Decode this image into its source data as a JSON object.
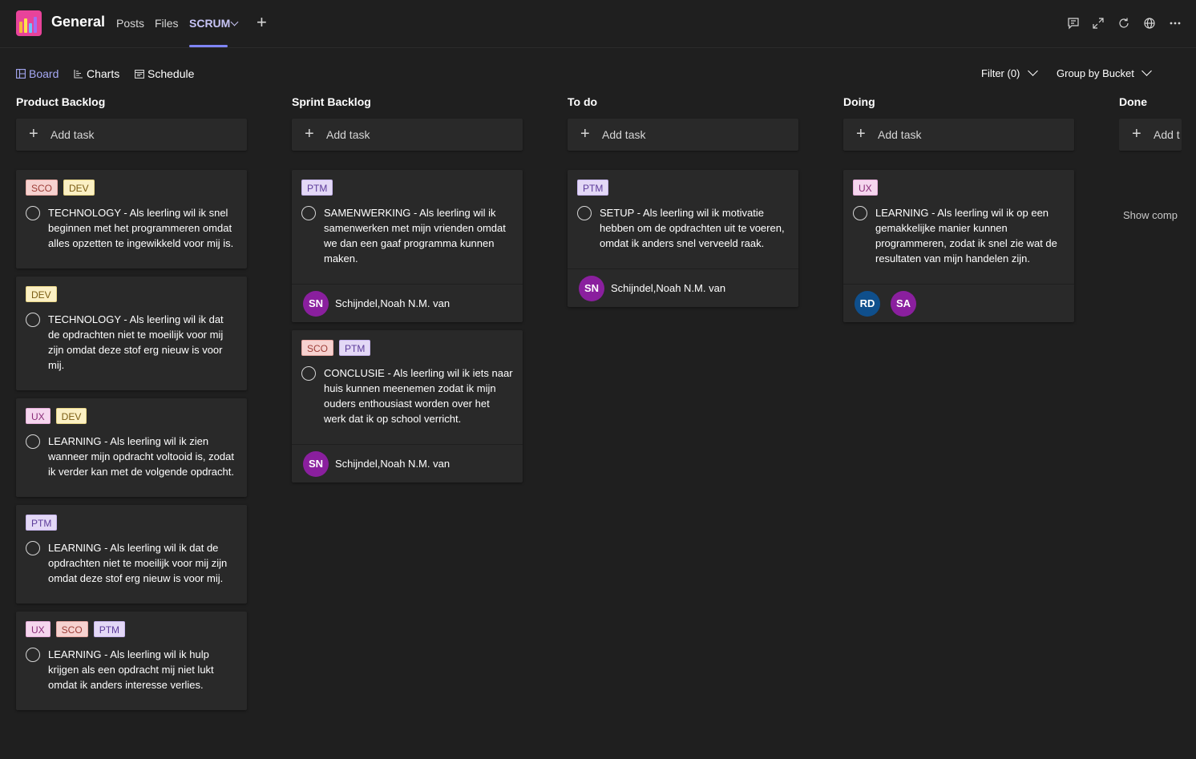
{
  "header": {
    "channel": "General",
    "tabs": [
      {
        "label": "Posts"
      },
      {
        "label": "Files"
      },
      {
        "label": "SCRUM"
      }
    ],
    "add_tab": "+"
  },
  "toolbar": {
    "board": "Board",
    "charts": "Charts",
    "schedule": "Schedule",
    "filter": "Filter (0)",
    "group_by": "Group by Bucket"
  },
  "colors": {
    "accent": "#7f85f5",
    "avatar_purple": "#8a1f9e",
    "avatar_blue": "#0f4f8c"
  },
  "columns": [
    {
      "title": "Product Backlog",
      "add_task": "Add task",
      "cards": [
        {
          "labels": [
            "SCO",
            "DEV"
          ],
          "text": "TECHNOLOGY - Als leerling wil ik snel beginnen met het programmeren omdat alles opzetten te ingewikkeld voor mij is."
        },
        {
          "labels": [
            "DEV"
          ],
          "text": "TECHNOLOGY - Als leerling wil ik dat de opdrachten niet te moeilijk voor mij zijn omdat deze stof erg nieuw is voor mij."
        },
        {
          "labels": [
            "UX",
            "DEV"
          ],
          "text": "LEARNING - Als leerling wil ik zien wanneer mijn opdracht voltooid is, zodat ik verder kan met de volgende opdracht."
        },
        {
          "labels": [
            "PTM"
          ],
          "text": "LEARNING - Als leerling wil ik dat de opdrachten niet te moeilijk voor mij zijn omdat deze stof erg nieuw is voor mij."
        },
        {
          "labels": [
            "UX",
            "SCO",
            "PTM"
          ],
          "text": "LEARNING - Als leerling wil ik hulp krijgen als een opdracht mij niet lukt omdat ik anders interesse verlies."
        }
      ]
    },
    {
      "title": "Sprint Backlog",
      "add_task": "Add task",
      "cards": [
        {
          "labels": [
            "PTM"
          ],
          "text": "SAMENWERKING - Als leerling wil ik samenwerken met mijn vrienden omdat we dan een gaaf programma kunnen maken.",
          "avatars": [
            "SN"
          ],
          "assignee": "Schijndel,Noah N.M. van"
        },
        {
          "labels": [
            "SCO",
            "PTM"
          ],
          "text": "CONCLUSIE - Als leerling wil ik iets naar huis kunnen meenemen zodat ik mijn ouders enthousiast worden over het werk dat ik op school verricht.",
          "avatars": [
            "SN"
          ],
          "assignee": "Schijndel,Noah N.M. van"
        }
      ]
    },
    {
      "title": "To do",
      "add_task": "Add task",
      "cards": [
        {
          "labels": [
            "PTM"
          ],
          "text": "SETUP - Als leerling wil ik motivatie hebben om de opdrachten uit te voeren, omdat ik anders snel verveeld raak.",
          "avatars": [
            "SN"
          ],
          "assignee": "Schijndel,Noah N.M. van"
        }
      ]
    },
    {
      "title": "Doing",
      "add_task": "Add task",
      "cards": [
        {
          "labels": [
            "UX"
          ],
          "text": "LEARNING - Als leerling wil ik op een gemakkelijke manier kunnen programmeren, zodat ik snel zie wat de resultaten van mijn handelen zijn.",
          "avatars": [
            "RD",
            "SA"
          ],
          "assignee": ""
        }
      ]
    },
    {
      "title": "Done",
      "add_task": "Add t",
      "show_completed": "Show comp",
      "cards": []
    }
  ]
}
